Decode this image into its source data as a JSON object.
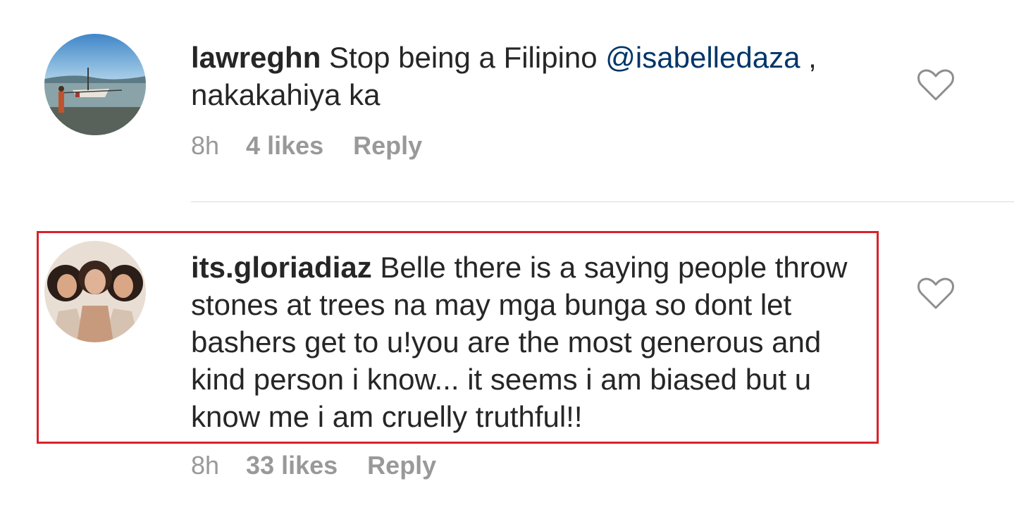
{
  "comments": [
    {
      "username": "lawreghn",
      "text_before": " Stop being a Filipino ",
      "mention": "@isabelledaza",
      "text_after": " , nakakahiya ka",
      "time": "8h",
      "likes": "4 likes",
      "reply": "Reply",
      "avatar_icon": "beach-boat-photo"
    },
    {
      "username": "its.gloriadiaz",
      "text_before": " Belle there is a saying people throw stones at trees na may mga bunga so dont let bashers get to u!you are the most generous and kind person i know... it seems i am biased but u know me i am cruelly truthful!!",
      "time": "8h",
      "likes": "33 likes",
      "reply": "Reply",
      "avatar_icon": "three-women-photo"
    }
  ],
  "icons": {
    "like": "heart-outline-icon"
  },
  "colors": {
    "text": "#262626",
    "meta": "#999999",
    "mention": "#003569",
    "highlight_border": "#d9222a",
    "divider": "#dbdbdb"
  }
}
